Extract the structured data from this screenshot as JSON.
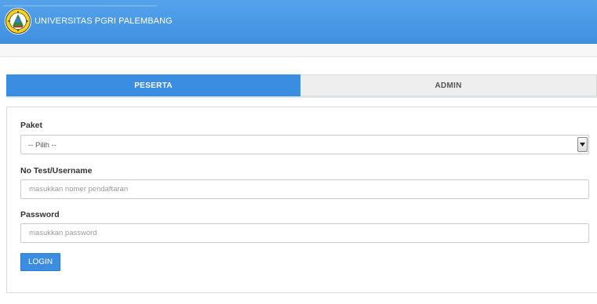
{
  "header": {
    "title": "UNIVERSITAS PGRI PALEMBANG",
    "logo_icon": "university-seal-icon"
  },
  "tabs": [
    {
      "label": "PESERTA",
      "active": true
    },
    {
      "label": "ADMIN",
      "active": false
    }
  ],
  "form": {
    "paket": {
      "label": "Paket",
      "selected": "-- Pilih --"
    },
    "username": {
      "label": "No Test/Username",
      "placeholder": "masukkan nomer pendaftaran",
      "value": ""
    },
    "password": {
      "label": "Password",
      "placeholder": "masukkan password",
      "value": ""
    },
    "login_label": "LOGIN"
  },
  "colors": {
    "header_blue": "#4a9be6",
    "accent_blue": "#3a8de0",
    "logo_yellow": "#f2d21b",
    "logo_green": "#2e8b3a"
  }
}
